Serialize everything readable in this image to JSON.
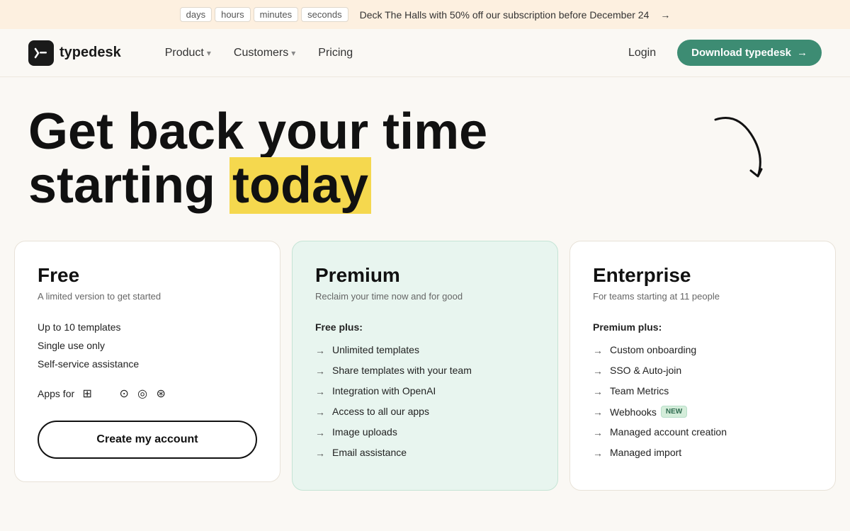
{
  "banner": {
    "timers": [
      "days",
      "hours",
      "minutes",
      "seconds"
    ],
    "text": "Deck The Halls with 50% off our subscription before December 24",
    "arrow": "→"
  },
  "nav": {
    "logo_text": "typedesk",
    "product_label": "Product",
    "customers_label": "Customers",
    "pricing_label": "Pricing",
    "login_label": "Login",
    "download_label": "Download typedesk",
    "download_arrow": "→"
  },
  "hero": {
    "line1": "Get back your time",
    "line2": "starting ",
    "line2_highlight": "today"
  },
  "cards": {
    "free": {
      "tier": "Free",
      "subtitle": "A limited version to get started",
      "features": [
        "Up to 10 templates",
        "Single use only",
        "Self-service assistance"
      ],
      "apps_label": "Apps for",
      "app_icons": [
        "⊞",
        "",
        "",
        "",
        ""
      ],
      "cta": "Create my account"
    },
    "premium": {
      "tier": "Premium",
      "subtitle": "Reclaim your time now and for good",
      "section_label": "Free plus:",
      "features": [
        "Unlimited templates",
        "Share templates with your team",
        "Integration with OpenAI",
        "Access to all our apps",
        "Image uploads",
        "Email assistance"
      ]
    },
    "enterprise": {
      "tier": "Enterprise",
      "subtitle": "For teams starting at 11 people",
      "section_label": "Premium plus:",
      "features": [
        "Custom onboarding",
        "SSO & Auto-join",
        "Team Metrics",
        "Webhooks",
        "Managed account creation",
        "Managed import"
      ],
      "webhooks_badge": "NEW"
    }
  }
}
